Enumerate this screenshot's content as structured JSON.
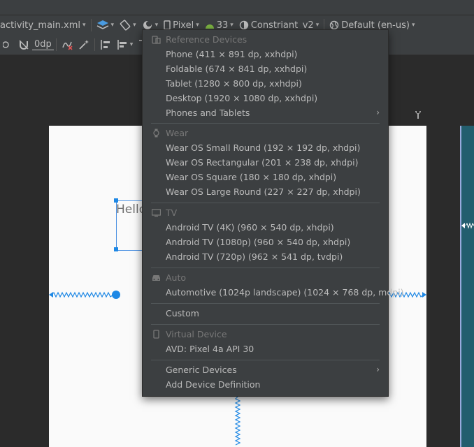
{
  "toolbar": {
    "file": "activity_main.xml",
    "device": "Pixel",
    "api": "33",
    "theme": "Constriant_v2",
    "locale": "Default (en-us)",
    "margin": "0dp"
  },
  "canvas": {
    "hello_text": "Hello"
  },
  "menu": {
    "reference_header": "Reference Devices",
    "reference_items": [
      "Phone (411 × 891 dp, xxhdpi)",
      "Foldable (674 × 841 dp, xxhdpi)",
      "Tablet (1280 × 800 dp, xxhdpi)",
      "Desktop (1920 × 1080 dp, xxhdpi)",
      "Phones and Tablets"
    ],
    "wear_header": "Wear",
    "wear_items": [
      "Wear OS Small Round (192 × 192 dp, xhdpi)",
      "Wear OS Rectangular (201 × 238 dp, xhdpi)",
      "Wear OS Square (180 × 180 dp, xhdpi)",
      "Wear OS Large Round (227 × 227 dp, xhdpi)"
    ],
    "tv_header": "TV",
    "tv_items": [
      "Android TV (4K) (960 × 540 dp, xhdpi)",
      "Android TV (1080p) (960 × 540 dp, xhdpi)",
      "Android TV (720p) (962 × 541 dp, tvdpi)"
    ],
    "auto_header": "Auto",
    "auto_items": [
      "Automotive (1024p landscape) (1024 × 768 dp, mdpi)"
    ],
    "custom": "Custom",
    "virtual_header": "Virtual Device",
    "virtual_items": [
      "AVD: Pixel 4a API 30"
    ],
    "generic": "Generic Devices",
    "add_definition": "Add Device Definition"
  }
}
